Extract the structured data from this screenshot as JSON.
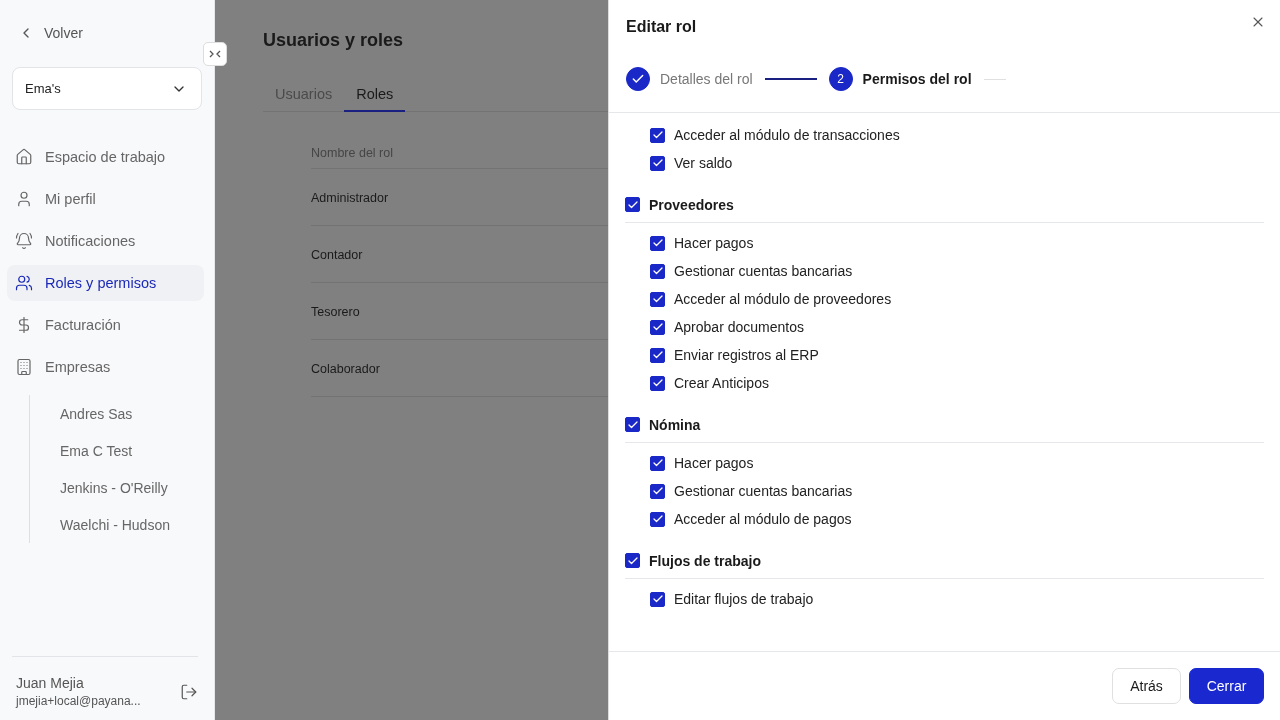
{
  "sidebar": {
    "back_label": "Volver",
    "company_select": {
      "value": "Ema's"
    },
    "nav": [
      {
        "label": "Espacio de trabajo",
        "selected": false
      },
      {
        "label": "Mi perfil",
        "selected": false
      },
      {
        "label": "Notificaciones",
        "selected": false
      },
      {
        "label": "Roles y permisos",
        "selected": true
      },
      {
        "label": "Facturación",
        "selected": false
      },
      {
        "label": "Empresas",
        "selected": false,
        "children": [
          {
            "label": "Andres Sas"
          },
          {
            "label": "Ema C Test"
          },
          {
            "label": "Jenkins - O'Reilly"
          },
          {
            "label": "Waelchi - Hudson"
          }
        ]
      }
    ],
    "user": {
      "name": "Juan Mejia",
      "email": "jmejia+local@payana..."
    }
  },
  "page": {
    "title": "Usuarios y roles",
    "tabs": [
      {
        "label": "Usuarios",
        "selected": false
      },
      {
        "label": "Roles",
        "selected": true
      }
    ],
    "table": {
      "columns": [
        "Nombre del rol"
      ],
      "rows": [
        [
          "Administrador"
        ],
        [
          "Contador"
        ],
        [
          "Tesorero"
        ],
        [
          "Colaborador"
        ]
      ]
    }
  },
  "drawer": {
    "title": "Editar rol",
    "steps": [
      {
        "label": "Detalles del rol",
        "done": true,
        "selected": false
      },
      {
        "label": "Permisos del rol",
        "number": "2",
        "done": false,
        "selected": true
      }
    ],
    "groups": [
      {
        "permissions": [
          {
            "label": "Acceder al módulo de transacciones",
            "checked": true
          },
          {
            "label": "Ver saldo",
            "checked": true
          }
        ]
      },
      {
        "label": "Proveedores",
        "checked": true,
        "permissions": [
          {
            "label": "Hacer pagos",
            "checked": true
          },
          {
            "label": "Gestionar cuentas bancarias",
            "checked": true
          },
          {
            "label": "Acceder al módulo de proveedores",
            "checked": true
          },
          {
            "label": "Aprobar documentos",
            "checked": true
          },
          {
            "label": "Enviar registros al ERP",
            "checked": true
          },
          {
            "label": "Crear Anticipos",
            "checked": true
          }
        ]
      },
      {
        "label": "Nómina",
        "checked": true,
        "permissions": [
          {
            "label": "Hacer pagos",
            "checked": true
          },
          {
            "label": "Gestionar cuentas bancarias",
            "checked": true
          },
          {
            "label": "Acceder al módulo de pagos",
            "checked": true
          }
        ]
      },
      {
        "label": "Flujos de trabajo",
        "checked": true,
        "permissions": [
          {
            "label": "Editar flujos de trabajo",
            "checked": true
          }
        ]
      }
    ],
    "buttons": [
      {
        "label": "Atrás",
        "kind": "secondary"
      },
      {
        "label": "Cerrar",
        "kind": "primary"
      }
    ]
  }
}
